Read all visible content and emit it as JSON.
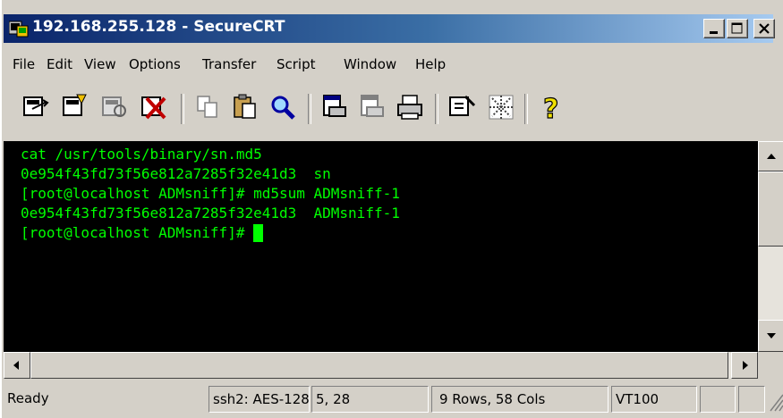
{
  "window": {
    "title": "192.168.255.128 - SecureCRT",
    "controls": {
      "minimize": "_",
      "maximize": "□",
      "close": "X"
    }
  },
  "menu": [
    "File",
    "Edit",
    "View",
    "Options",
    "Transfer",
    "Script",
    "Window",
    "Help"
  ],
  "toolbar": {
    "icons": [
      "connect-icon",
      "quick-connect-icon",
      "reconnect-icon",
      "disconnect-icon",
      "copy-icon",
      "paste-icon",
      "find-icon",
      "print-setup-icon",
      "print-selection-icon",
      "print-icon",
      "session-options-icon",
      "global-options-icon",
      "help-icon"
    ],
    "help_glyph": "?"
  },
  "terminal": {
    "lines": [
      "cat /usr/tools/binary/sn.md5",
      "0e954f43fd73f56e812a7285f32e41d3  sn",
      "[root@localhost ADMsniff]# md5sum ADMsniff-1",
      "0e954f43fd73f56e812a7285f32e41d3  ADMsniff-1",
      "[root@localhost ADMsniff]# "
    ],
    "text_color": "#00ff00",
    "background": "#000000"
  },
  "statusbar": {
    "ready": "Ready",
    "protocol": "ssh2: AES-128",
    "position": "5,  28",
    "size": "9 Rows, 58 Cols",
    "emulation": "VT100"
  }
}
